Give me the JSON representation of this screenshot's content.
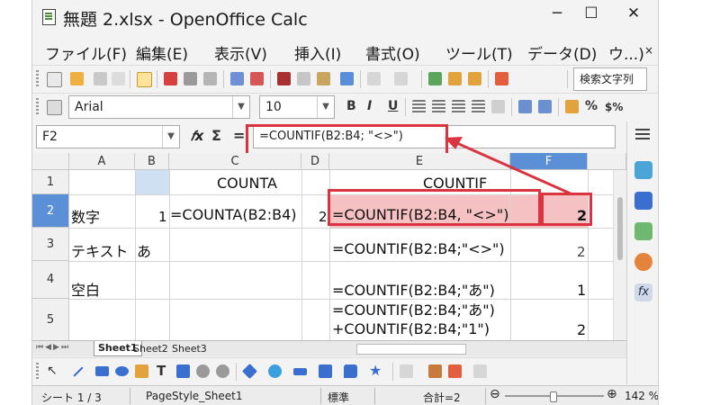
{
  "window": {
    "title": "無題 2.xlsx - OpenOffice Calc",
    "minimize": "─",
    "maximize": "☐",
    "close": "✕"
  },
  "menu": [
    "ファイル(F)",
    "編集(E)",
    "表示(V)",
    "挿入(I)",
    "書式(O)",
    "ツール(T)",
    "データ(D)",
    "ウ...)",
    "×"
  ],
  "toolbar": {
    "search_label": "検索文字列",
    "font_name": "Arial",
    "font_size": "10",
    "bold": "B",
    "italic": "I",
    "underline": "U",
    "percent": "%",
    "currency": "$%"
  },
  "formula_bar": {
    "cell_ref": "F2",
    "func_icon": "𝑓x",
    "sum_icon": "Σ",
    "equals_icon": "=",
    "formula": "=COUNTIF(B2:B4; \"<>\")"
  },
  "grid": {
    "columns": [
      "A",
      "B",
      "C",
      "D",
      "E",
      "F"
    ],
    "rows": [
      "1",
      "2",
      "3",
      "4",
      "5"
    ],
    "cells": {
      "C1": "COUNTA",
      "E1": "COUNTIF",
      "A2": "数字",
      "B2": "1",
      "C2": "=COUNTA(B2:B4)",
      "D2": "2",
      "E2": "=COUNTIF(B2:B4, \"<>\")",
      "F2": "2",
      "A3": "テキスト",
      "B3": "あ",
      "E3": "=COUNTIF(B2:B4;\"<>\")",
      "F3": "2",
      "A4": "空白",
      "E4": "=COUNTIF(B2:B4;\"あ\")",
      "F4": "1",
      "E5a": "=COUNTIF(B2:B4;\"あ\")",
      "E5b": "+COUNTIF(B2:B4;\"1\")",
      "F5": "2"
    }
  },
  "sheet_tabs": [
    "Sheet1",
    "Sheet2",
    "Sheet3"
  ],
  "status": {
    "sheet": "シート 1 / 3",
    "page_style": "PageStyle_Sheet1",
    "mode": "標準",
    "sum": "合計=2",
    "zoom": "142 %",
    "zoom_minus": "⊖",
    "zoom_plus": "⊕"
  },
  "colors": {
    "selection_fill": "#f6c1c3",
    "annotation_red": "#d9343f",
    "active_header": "#cfe0f3"
  }
}
